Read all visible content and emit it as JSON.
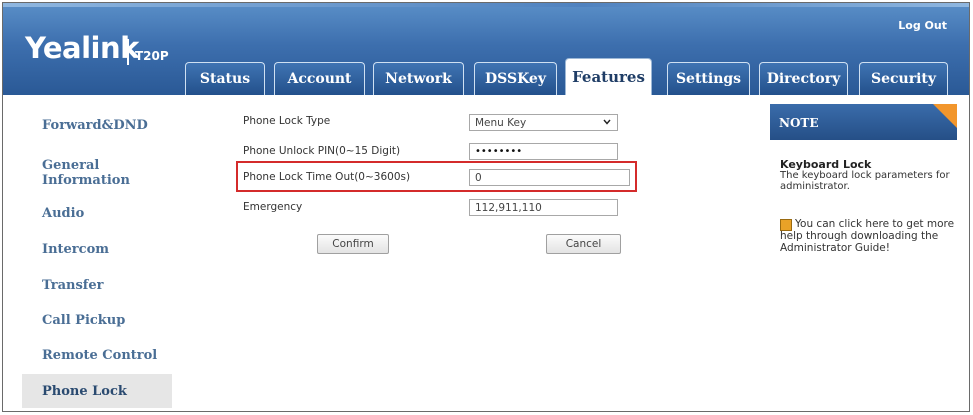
{
  "header": {
    "brand": "Yealink",
    "model": "T20P",
    "logout_label": "Log Out"
  },
  "tabs": [
    {
      "label": "Status"
    },
    {
      "label": "Account"
    },
    {
      "label": "Network"
    },
    {
      "label": "DSSKey"
    },
    {
      "label": "Features",
      "active": true
    },
    {
      "label": "Settings"
    },
    {
      "label": "Directory"
    },
    {
      "label": "Security"
    }
  ],
  "sidebar": {
    "items": [
      {
        "label": "Forward&DND"
      },
      {
        "label": "General Information"
      },
      {
        "label": "Audio"
      },
      {
        "label": "Intercom"
      },
      {
        "label": "Transfer"
      },
      {
        "label": "Call Pickup"
      },
      {
        "label": "Remote Control"
      },
      {
        "label": "Phone Lock",
        "active": true
      }
    ]
  },
  "form": {
    "lock_type": {
      "label": "Phone Lock Type",
      "value": "Menu Key"
    },
    "unlock_pin": {
      "label": "Phone Unlock PIN(0~15 Digit)",
      "value": "••••••••"
    },
    "timeout": {
      "label": "Phone Lock Time Out(0~3600s)",
      "value": "0"
    },
    "emergency": {
      "label": "Emergency",
      "value": "112,911,110"
    },
    "confirm_label": "Confirm",
    "cancel_label": "Cancel"
  },
  "note": {
    "header": "NOTE",
    "title": "Keyboard Lock",
    "body": "The keyboard lock parameters for administrator.",
    "help": "You can click here to get more help through downloading the Administrator Guide!"
  },
  "colors": {
    "header_blue": "#3d6fae",
    "highlight_red": "#d42b2b",
    "note_corner_orange": "#f2962c",
    "sidebar_text": "#4a6e95"
  }
}
